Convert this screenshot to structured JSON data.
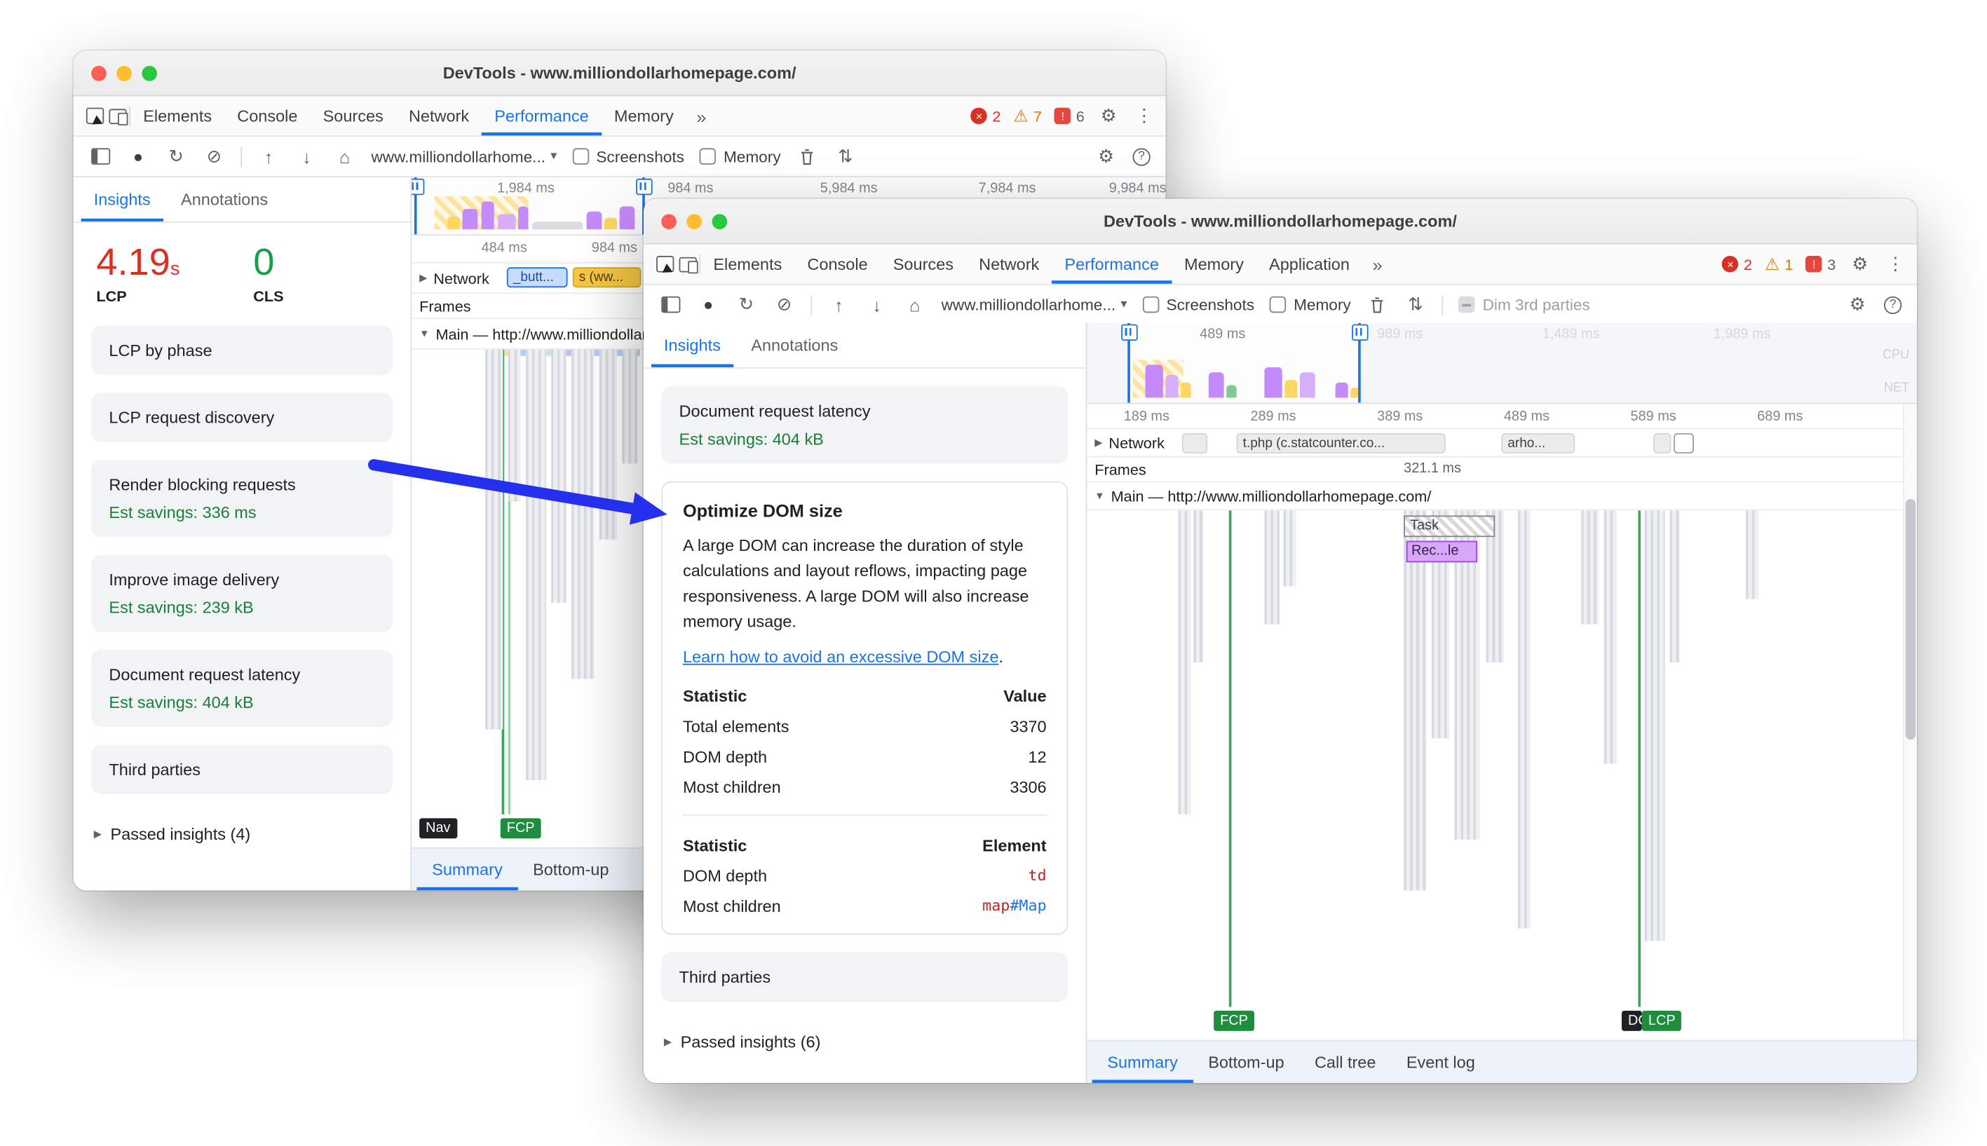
{
  "icons": {
    "more": "»",
    "caret": "▾",
    "gear": "⚙",
    "kebab": "⋮",
    "help": "?",
    "record": "●",
    "reload": "↻",
    "block": "⊘",
    "upload": "↑",
    "download": "↓",
    "home": "⌂",
    "warning": "⚠",
    "close": "×",
    "exclaim": "!",
    "expand_right": "▶",
    "expand_down": "▼",
    "updown": "⇅"
  },
  "arrow": {
    "color": "#2430ee"
  },
  "w1": {
    "title": "DevTools - www.milliondollarhomepage.com/",
    "tabs": [
      "Elements",
      "Console",
      "Sources",
      "Network",
      "Performance",
      "Memory"
    ],
    "badges": {
      "errors": "2",
      "warnings": "7",
      "issues": "6"
    },
    "toolbar": {
      "url": "www.milliondollarhome...",
      "screenshots": "Screenshots",
      "memory": "Memory"
    },
    "overview_labels": [
      "1,984 ms",
      "984 ms",
      "5,984 ms",
      "7,984 ms",
      "9,984 ms"
    ],
    "ruler": [
      "484 ms",
      "984 ms"
    ],
    "panel": {
      "tabs": [
        "Insights",
        "Annotations"
      ],
      "lcp_value": "4.19",
      "lcp_unit": "s",
      "lcp_label": "LCP",
      "cls_value": "0",
      "cls_label": "CLS",
      "cards": [
        {
          "title": "LCP by phase",
          "subtitle": ""
        },
        {
          "title": "LCP request discovery",
          "subtitle": ""
        },
        {
          "title": "Render blocking requests",
          "subtitle": "Est savings: 336 ms"
        },
        {
          "title": "Improve image delivery",
          "subtitle": "Est savings: 239 kB"
        },
        {
          "title": "Document request latency",
          "subtitle": "Est savings: 404 kB"
        },
        {
          "title": "Third parties",
          "subtitle": ""
        }
      ],
      "passed": "Passed insights (4)"
    },
    "tracks": {
      "network": "Network",
      "frames": "Frames",
      "main": "Main — http://www.milliondollarhomepage.com/",
      "chip_blue": "_butt...",
      "chip_yellow": "s (ww..."
    },
    "markers": {
      "nav": "Nav",
      "fcp": "FCP"
    },
    "bottom_tabs": [
      "Summary",
      "Bottom-up"
    ]
  },
  "w2": {
    "title": "DevTools - www.milliondollarhomepage.com/",
    "tabs": [
      "Elements",
      "Console",
      "Sources",
      "Network",
      "Performance",
      "Memory",
      "Application"
    ],
    "badges": {
      "errors": "2",
      "warnings": "1",
      "issues": "3"
    },
    "toolbar": {
      "url": "www.milliondollarhome...",
      "screenshots": "Screenshots",
      "memory": "Memory",
      "dim": "Dim 3rd parties"
    },
    "overview_labels": [
      "489 ms",
      "989 ms",
      "1,489 ms",
      "1,989 ms"
    ],
    "overview_cpu": "CPU",
    "overview_net": "NET",
    "ruler": [
      "189 ms",
      "289 ms",
      "389 ms",
      "489 ms",
      "589 ms",
      "689 ms"
    ],
    "panel": {
      "tabs": [
        "Insights",
        "Annotations"
      ],
      "latency_card": {
        "title": "Document request latency",
        "subtitle": "Est savings: 404 kB"
      },
      "dom_card": {
        "title": "Optimize DOM size",
        "body": "A large DOM can increase the duration of style calculations and layout reflows, impacting page responsiveness. A large DOM will also increase memory usage.",
        "link": "Learn how to avoid an excessive DOM size",
        "link_suffix": ".",
        "t1_header": [
          "Statistic",
          "Value"
        ],
        "t1_rows": [
          [
            "Total elements",
            "3370"
          ],
          [
            "DOM depth",
            "12"
          ],
          [
            "Most children",
            "3306"
          ]
        ],
        "t2_header": [
          "Statistic",
          "Element"
        ],
        "t2_row1_label": "DOM depth",
        "t2_row1_value": "td",
        "t2_row2_label": "Most children",
        "t2_row2_value_tag": "map",
        "t2_row2_value_id": "#Map"
      },
      "third_card": {
        "title": "Third parties"
      },
      "passed": "Passed insights (6)"
    },
    "tracks": {
      "network": "Network",
      "frames": "Frames",
      "frames_time": "321.1 ms",
      "main": "Main — http://www.milliondollarhomepage.com/",
      "chip1": "t.php (c.statcounter.co...",
      "chip2": "arho...",
      "task": "Task",
      "recalc": "Rec...le"
    },
    "markers": {
      "fcp": "FCP",
      "dcl": "DCL",
      "lcp": "LCP"
    },
    "bottom_tabs": [
      "Summary",
      "Bottom-up",
      "Call tree",
      "Event log"
    ]
  }
}
